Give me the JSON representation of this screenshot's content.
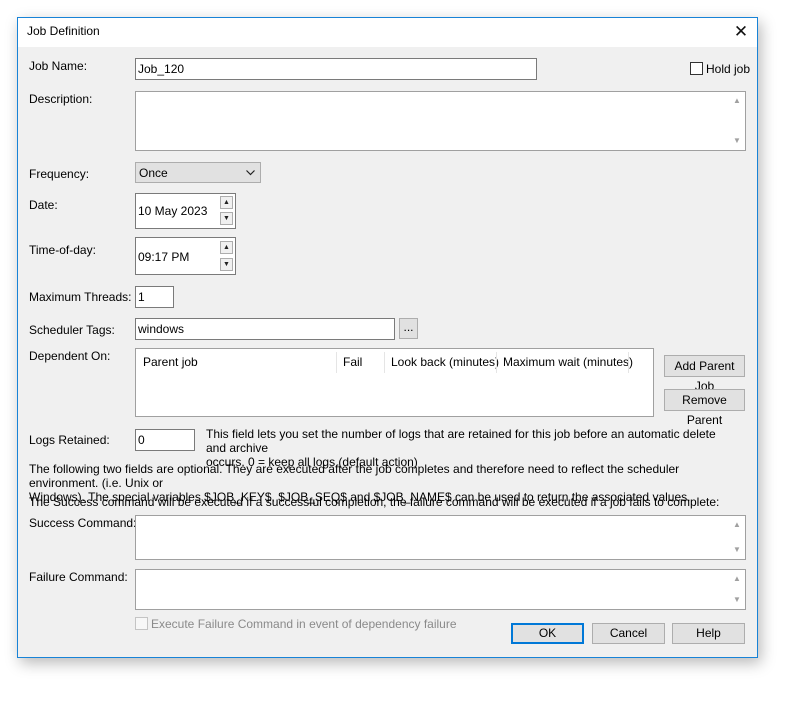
{
  "window": {
    "title": "Job Definition",
    "close_glyph": "✕"
  },
  "job_name": {
    "label": "Job Name:",
    "value": "Job_120"
  },
  "hold_job": {
    "label": "Hold job",
    "checked": false
  },
  "description": {
    "label": "Description:",
    "value": ""
  },
  "frequency": {
    "label": "Frequency:",
    "value": "Once"
  },
  "date": {
    "label": "Date:",
    "value": "10 May 2023"
  },
  "time_of_day": {
    "label": "Time-of-day:",
    "value": "09:17 PM"
  },
  "max_threads": {
    "label": "Maximum Threads:",
    "value": "1"
  },
  "scheduler_tags": {
    "label": "Scheduler Tags:",
    "value": "windows",
    "browse_label": "..."
  },
  "dependent_on": {
    "label": "Dependent On:",
    "columns": [
      "Parent job",
      "Fail",
      "Look back (minutes)",
      "Maximum wait (minutes)"
    ],
    "rows": [],
    "add_parent_label": "Add Parent Job",
    "remove_parent_label": "Remove Parent"
  },
  "logs_retained": {
    "label": "Logs Retained:",
    "value": "0",
    "help_line1": "This field lets you set the number of logs that are retained for this job before an automatic delete and archive",
    "help_line2": "occurs. 0 = keep all logs (default action)"
  },
  "notes": {
    "line1": "The following two fields are optional. They are executed after the job completes and therefore need to reflect the scheduler environment. (i.e. Unix or",
    "line2": "Windows). The special variables $JOB_KEY$, $JOB_SEQ$ and $JOB_NAME$ can be used to return the associated values.",
    "line3": "The Success command will be executed if a successful completion, the failure command will be executed if a job fails to complete:"
  },
  "success_command": {
    "label": "Success Command:",
    "value": ""
  },
  "failure_command": {
    "label": "Failure Command:",
    "value": ""
  },
  "execute_failure": {
    "label": "Execute Failure Command in event of dependency failure",
    "checked": false,
    "enabled": false
  },
  "buttons": {
    "ok": "OK",
    "cancel": "Cancel",
    "help": "Help"
  },
  "colors": {
    "dialog_bg": "#f0f0f0",
    "accent": "#0078d7",
    "window_border": "#1883d7"
  }
}
